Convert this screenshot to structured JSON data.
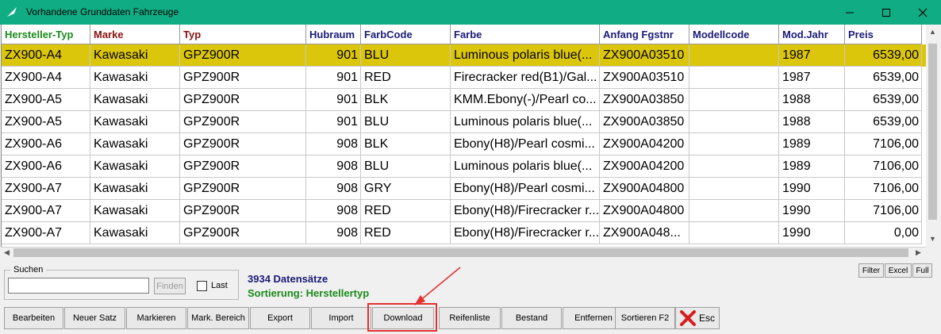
{
  "window": {
    "title": "Vorhandene Grunddaten Fahrzeuge"
  },
  "columns": [
    {
      "label": "Hersteller-Typ",
      "color": "#1a8a1a"
    },
    {
      "label": "Marke",
      "color": "#8b1010"
    },
    {
      "label": "Typ",
      "color": "#8b1010"
    },
    {
      "label": "Hubraum",
      "color": "#1a1a7a"
    },
    {
      "label": "FarbCode",
      "color": "#1a1a7a"
    },
    {
      "label": "Farbe",
      "color": "#1a1a7a"
    },
    {
      "label": "Anfang Fgstnr",
      "color": "#1a1a7a"
    },
    {
      "label": "Modellcode",
      "color": "#1a1a7a"
    },
    {
      "label": "Mod.Jahr",
      "color": "#1a1a7a"
    },
    {
      "label": "Preis",
      "color": "#1a1a7a"
    }
  ],
  "rows": [
    [
      "ZX900-A4",
      "Kawasaki",
      "GPZ900R",
      "901",
      "BLU",
      "Luminous polaris blue(...",
      "ZX900A03510",
      "",
      "1987",
      "6539,00"
    ],
    [
      "ZX900-A4",
      "Kawasaki",
      "GPZ900R",
      "901",
      "RED",
      "Firecracker red(B1)/Gal...",
      "ZX900A03510",
      "",
      "1987",
      "6539,00"
    ],
    [
      "ZX900-A5",
      "Kawasaki",
      "GPZ900R",
      "901",
      "BLK",
      "KMM.Ebony(-)/Pearl co...",
      "ZX900A03850",
      "",
      "1988",
      "6539,00"
    ],
    [
      "ZX900-A5",
      "Kawasaki",
      "GPZ900R",
      "901",
      "BLU",
      "Luminous polaris blue(...",
      "ZX900A03850",
      "",
      "1988",
      "6539,00"
    ],
    [
      "ZX900-A6",
      "Kawasaki",
      "GPZ900R",
      "908",
      "BLK",
      "Ebony(H8)/Pearl cosmi...",
      "ZX900A04200",
      "",
      "1989",
      "7106,00"
    ],
    [
      "ZX900-A6",
      "Kawasaki",
      "GPZ900R",
      "908",
      "BLU",
      "Luminous polaris blue(...",
      "ZX900A04200",
      "",
      "1989",
      "7106,00"
    ],
    [
      "ZX900-A7",
      "Kawasaki",
      "GPZ900R",
      "908",
      "GRY",
      "Ebony(H8)/Pearl cosmi...",
      "ZX900A04800",
      "",
      "1990",
      "7106,00"
    ],
    [
      "ZX900-A7",
      "Kawasaki",
      "GPZ900R",
      "908",
      "RED",
      "Ebony(H8)/Firecracker r...",
      "ZX900A04800",
      "",
      "1990",
      "7106,00"
    ],
    [
      "ZX900-A7",
      "Kawasaki",
      "GPZ900R",
      "908",
      "RED",
      "Ebony(H8)/Firecracker r...",
      "ZX900A048...",
      "",
      "1990",
      "0,00"
    ]
  ],
  "selected_row": 0,
  "search": {
    "legend": "Suchen",
    "value": "",
    "find_label": "Finden",
    "last_label": "Last",
    "last_checked": false
  },
  "status": {
    "count": "3934 Datensätze",
    "sort": "Sortierung: Herstellertyp",
    "count_color": "#1a1a7a",
    "sort_color": "#1a8a1a"
  },
  "view_buttons": [
    "Filter",
    "Excel",
    "Full"
  ],
  "toolbar": [
    "Bearbeiten",
    "Neuer Satz",
    "Markieren",
    "Mark. Bereich",
    "Export",
    "Import",
    "Download",
    "Reifenliste",
    "Bestand",
    "Entfernen",
    "Sortieren F2",
    "Esc"
  ],
  "highlighted_button": "Download",
  "colors": {
    "titlebar": "#10ac84",
    "selection": "#dcc60c",
    "annotation": "#e53030"
  },
  "icons": {
    "app": "app-icon",
    "minimize": "minimize-icon",
    "maximize": "maximize-icon",
    "close": "close-icon",
    "esc": "red-x-icon"
  }
}
